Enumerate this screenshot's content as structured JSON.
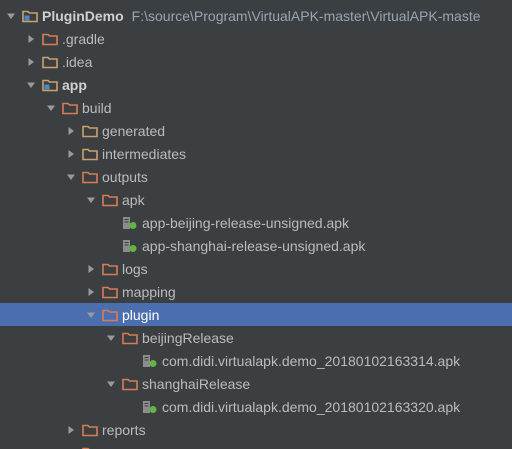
{
  "tree": {
    "root": {
      "label": "PluginDemo",
      "path": "F:\\source\\Program\\VirtualAPK-master\\VirtualAPK-maste"
    },
    "items": {
      "gradle": ".gradle",
      "idea": ".idea",
      "app": "app",
      "build": "build",
      "generated": "generated",
      "intermediates": "intermediates",
      "outputs": "outputs",
      "apk": "apk",
      "apk_beijing": "app-beijing-release-unsigned.apk",
      "apk_shanghai": "app-shanghai-release-unsigned.apk",
      "logs": "logs",
      "mapping": "mapping",
      "plugin": "plugin",
      "beijingRelease": "beijingRelease",
      "beijing_file": "com.didi.virtualapk.demo_20180102163314.apk",
      "shanghaiRelease": "shanghaiRelease",
      "shanghai_file": "com.didi.virtualapk.demo_20180102163320.apk",
      "reports": "reports"
    }
  },
  "colors": {
    "background": "#3c3f41",
    "selection": "#4b6eaf",
    "folder": "#d87c54",
    "module_folder": "#c9a26b",
    "apk_green": "#6a8759"
  }
}
